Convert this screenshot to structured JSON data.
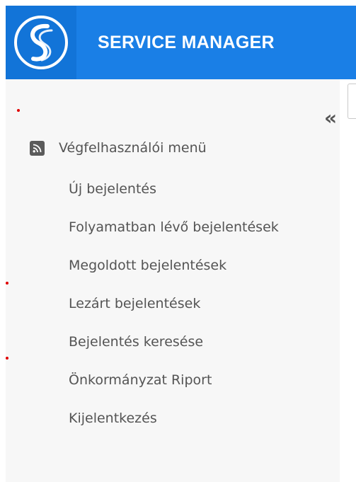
{
  "header": {
    "title": "SERVICE MANAGER",
    "logo_icon": "service-manager-s-logo"
  },
  "sidebar": {
    "collapse_label": "«",
    "menu_header": {
      "label": "Végfelhasználói menü",
      "icon": "rss-icon"
    },
    "items": [
      {
        "label": "Új bejelentés"
      },
      {
        "label": "Folyamatban lévő bejelentések"
      },
      {
        "label": "Megoldott bejelentések"
      },
      {
        "label": "Lezárt bejelentések"
      },
      {
        "label": "Bejelentés keresése"
      },
      {
        "label": "Önkormányzat Riport"
      },
      {
        "label": "Kijelentkezés"
      }
    ]
  },
  "colors": {
    "header_bg": "#1a7fe6",
    "logo_bg": "#1274d8",
    "sidebar_bg": "#f7f7f7",
    "text": "#545454"
  }
}
